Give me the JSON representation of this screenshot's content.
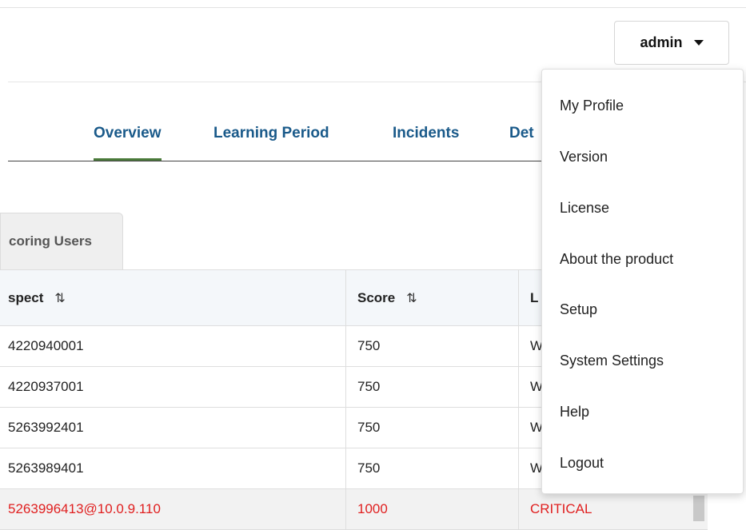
{
  "header": {
    "user_label": "admin"
  },
  "tabs": [
    {
      "label": "Overview",
      "active": true
    },
    {
      "label": "Learning Period",
      "active": false
    },
    {
      "label": "Incidents",
      "active": false
    },
    {
      "label": "Det",
      "active": false
    }
  ],
  "subtab": {
    "label": "coring Users"
  },
  "table": {
    "columns": [
      "spect",
      "Score",
      "L"
    ],
    "rows": [
      {
        "suspect": "4220940001",
        "score": "750",
        "level": "W"
      },
      {
        "suspect": "4220937001",
        "score": "750",
        "level": "W"
      },
      {
        "suspect": "5263992401",
        "score": "750",
        "level": "W"
      },
      {
        "suspect": "5263989401",
        "score": "750",
        "level": "W"
      },
      {
        "suspect": "5263996413@10.0.9.110",
        "score": "1000",
        "level": "CRITICAL"
      }
    ]
  },
  "user_menu": {
    "items": [
      "My Profile",
      "Version",
      "License",
      "About the product",
      "Setup",
      "System Settings",
      "Help",
      "Logout"
    ]
  },
  "icons": {
    "sort": "sort-arrows-icon",
    "caret": "caret-down-icon"
  },
  "colors": {
    "tab_text": "#1a5a8a",
    "active_underline": "#4a7a3a",
    "critical": "#e02020"
  }
}
